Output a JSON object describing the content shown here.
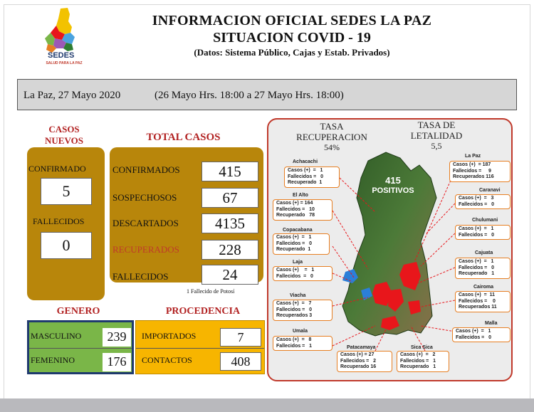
{
  "header": {
    "logo_text": "SEDES",
    "logo_sub": "SALUD PARA LA PAZ",
    "title_line1": "INFORMACION OFICIAL SEDES LA PAZ",
    "title_line2": "SITUACION  COVID - 19",
    "title_line3": "(Datos: Sistema Público, Cajas y Estab. Privados)"
  },
  "date_bar": {
    "date": "La Paz, 27 Mayo  2020",
    "range": "(26 Mayo Hrs. 18:00 a 27 Mayo Hrs. 18:00)"
  },
  "casos_nuevos": {
    "title_line1": "CASOS",
    "title_line2": "NUEVOS",
    "confirmado_label": "CONFIRMADO",
    "confirmado_value": "5",
    "fallecidos_label": "FALLECIDOS",
    "fallecidos_value": "0"
  },
  "total_casos": {
    "title": "TOTAL CASOS",
    "rows": [
      {
        "label": "CONFIRMADOS",
        "value": "415"
      },
      {
        "label": "SOSPECHOSOS",
        "value": "67"
      },
      {
        "label": "DESCARTADOS",
        "value": "4135"
      },
      {
        "label": "RECUPERADOS",
        "value": "228"
      },
      {
        "label": "FALLECIDOS",
        "value": "24"
      }
    ],
    "note": "1 Fallecido de Potosí"
  },
  "genero": {
    "title": "GENERO",
    "rows": [
      {
        "label": "MASCULINO",
        "value": "239"
      },
      {
        "label": "FEMENINO",
        "value": "176"
      }
    ]
  },
  "procedencia": {
    "title": "PROCEDENCIA",
    "rows": [
      {
        "label": "IMPORTADOS",
        "value": "7"
      },
      {
        "label": "CONTACTOS",
        "value": "408"
      }
    ]
  },
  "map": {
    "tasa_rec_line1": "TASA",
    "tasa_rec_line2": "RECUPERACION",
    "tasa_rec_value": "54%",
    "tasa_let_line1": "TASA  DE",
    "tasa_let_line2": "LETALIDAD",
    "tasa_let_value": "5,5",
    "positivos_value": "415",
    "positivos_label": "POSITIVOS",
    "colors": {
      "border": "#c0392b",
      "box_border": "#e67e22",
      "map_green": "#3e6b2f",
      "case_red": "#e8161b",
      "blue": "#2b7fd9"
    },
    "regions": [
      {
        "name": "Achacachi",
        "lines": [
          "Casos (+)  =   1",
          "Fallecidos =   0",
          "Recuperado  1"
        ]
      },
      {
        "name": "El Alto",
        "lines": [
          "Casos (+) = 164",
          "Fallecidos =   10",
          "Recuperado   78"
        ]
      },
      {
        "name": "Copacabana",
        "lines": [
          "Casos (+)  =   1",
          "Fallecidos =   0",
          "Recuperado  1"
        ]
      },
      {
        "name": "Laja",
        "lines": [
          "Casos (+)    =   1",
          "Fallecidos  =   0"
        ]
      },
      {
        "name": "Viacha",
        "lines": [
          "Casos (+)  =   7",
          "Fallecidos =   0",
          "Recuperados 3"
        ]
      },
      {
        "name": "Umala",
        "lines": [
          "Casos (+)  =   8",
          "Fallecidos =   1"
        ]
      },
      {
        "name": "Patacamaya",
        "lines": [
          "Casos (+) = 27",
          "Fallecidos =   2",
          "Recuperado 16"
        ]
      },
      {
        "name": "Sica Sica",
        "lines": [
          "Casos (+)  =   2",
          "Fallecidos =   1",
          "Recuperado   1"
        ]
      },
      {
        "name": "La Paz",
        "lines": [
          "Casos (+)  = 187",
          "Fallecidos =     9",
          "Recuperados 116"
        ]
      },
      {
        "name": "Caranavi",
        "lines": [
          "Casos (+)  =   3",
          "Fallecidos =   0"
        ]
      },
      {
        "name": "Chulumani",
        "lines": [
          "Casos (+)  =   1",
          "Fallecidos =   0"
        ]
      },
      {
        "name": "Cajuata",
        "lines": [
          "Casos (+)  =   1",
          "Fallecidos =   0",
          "Recuperado   1"
        ]
      },
      {
        "name": "Cairoma",
        "lines": [
          "Casos (+)  =  11",
          "Fallecidos =    0",
          "Recuperados 11"
        ]
      },
      {
        "name": "Malla",
        "lines": [
          "Casos (+)  =   1",
          "Fallecidos =   0"
        ]
      }
    ]
  }
}
